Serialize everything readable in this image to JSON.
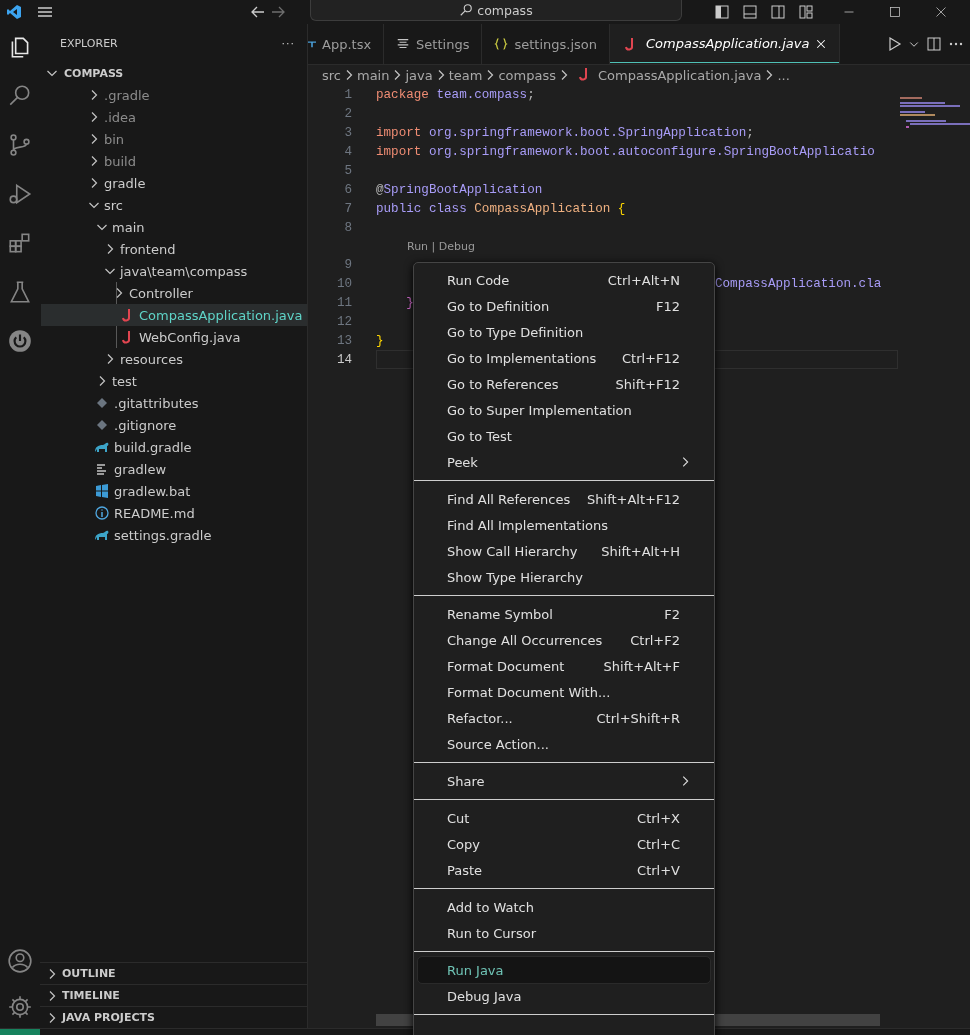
{
  "title_bar": {
    "search": "compass"
  },
  "activity_bar": {
    "top": [
      {
        "kind": "files",
        "selected": true
      },
      {
        "kind": "search",
        "selected": false
      },
      {
        "kind": "branch",
        "selected": false
      },
      {
        "kind": "debug",
        "selected": false
      },
      {
        "kind": "blocks",
        "selected": false
      },
      {
        "kind": "flask",
        "selected": false
      },
      {
        "kind": "power",
        "selected": false
      }
    ],
    "bottom": [
      {
        "kind": "account"
      },
      {
        "kind": "gear"
      }
    ]
  },
  "sidebar": {
    "title": "EXPLORER",
    "more": "···",
    "root": {
      "name": "COMPASS",
      "expanded": true
    },
    "tree": [
      {
        "name": ".gradle",
        "kind": "folder",
        "expanded": false,
        "ignored": true,
        "selected": false
      },
      {
        "name": ".idea",
        "kind": "folder",
        "expanded": false,
        "ignored": true,
        "selected": false
      },
      {
        "name": "bin",
        "kind": "folder",
        "expanded": false,
        "ignored": true,
        "selected": false
      },
      {
        "name": "build",
        "kind": "folder",
        "expanded": false,
        "ignored": true,
        "selected": false
      },
      {
        "name": "gradle",
        "kind": "folder",
        "expanded": false,
        "ignored": false,
        "selected": false
      },
      {
        "name": "src",
        "kind": "folder",
        "expanded": true,
        "ignored": false,
        "selected": false,
        "children": [
          {
            "name": "main",
            "kind": "folder",
            "expanded": true,
            "ignored": false,
            "selected": false,
            "children": [
              {
                "name": "frontend",
                "kind": "folder",
                "expanded": false,
                "ignored": false,
                "selected": false
              },
              {
                "name": "java\\team\\compass",
                "kind": "folder",
                "expanded": true,
                "ignored": false,
                "selected": false,
                "children": [
                  {
                    "name": "Controller",
                    "kind": "folder",
                    "expanded": false,
                    "ignored": false,
                    "selected": false
                  },
                  {
                    "name": "CompassApplication.java",
                    "kind": "java",
                    "ignored": false,
                    "selected": true
                  },
                  {
                    "name": "WebConfig.java",
                    "kind": "java",
                    "ignored": false,
                    "selected": false
                  }
                ]
              },
              {
                "name": "resources",
                "kind": "folder",
                "expanded": false,
                "ignored": false,
                "selected": false
              }
            ]
          },
          {
            "name": "test",
            "kind": "folder",
            "expanded": false,
            "ignored": false,
            "selected": false
          }
        ]
      },
      {
        "name": ".gitattributes",
        "kind": "git",
        "ignored": false,
        "selected": false
      },
      {
        "name": ".gitignore",
        "kind": "git",
        "ignored": false,
        "selected": false
      },
      {
        "name": "build.gradle",
        "kind": "gradle",
        "ignored": false,
        "selected": false
      },
      {
        "name": "gradlew",
        "kind": "text",
        "ignored": false,
        "selected": false
      },
      {
        "name": "gradlew.bat",
        "kind": "windows",
        "ignored": false,
        "selected": false
      },
      {
        "name": "README.md",
        "kind": "info",
        "ignored": false,
        "selected": false
      },
      {
        "name": "settings.gradle",
        "kind": "gradle",
        "ignored": false,
        "selected": false
      }
    ],
    "sections": [
      {
        "label": "OUTLINE",
        "expanded": false
      },
      {
        "label": "TIMELINE",
        "expanded": false
      },
      {
        "label": "JAVA PROJECTS",
        "expanded": false
      }
    ]
  },
  "tabs": [
    {
      "label": "App.tsx",
      "kind": "ts",
      "selected": false,
      "preview": false
    },
    {
      "label": "Settings",
      "kind": "settings",
      "selected": false,
      "preview": false
    },
    {
      "label": "settings.json",
      "kind": "json",
      "selected": false,
      "preview": false
    },
    {
      "label": "CompassApplication.java",
      "kind": "java",
      "selected": true,
      "preview": true
    }
  ],
  "breadcrumb": [
    {
      "text": "src",
      "kind": "folder"
    },
    {
      "text": "main",
      "kind": "folder"
    },
    {
      "text": "java",
      "kind": "folder"
    },
    {
      "text": "team",
      "kind": "folder"
    },
    {
      "text": "compass",
      "kind": "folder"
    },
    {
      "text": "CompassApplication.java",
      "kind": "java"
    },
    {
      "text": "...",
      "kind": "more"
    }
  ],
  "code": [
    {
      "number": "1",
      "kind": "code",
      "current": false,
      "tokens": [
        {
          "text": "package",
          "kind": "keyword"
        },
        {
          "text": " team.compass",
          "kind": "name"
        },
        {
          "text": ";",
          "kind": "plain"
        }
      ]
    },
    {
      "number": "2",
      "kind": "code",
      "current": false
    },
    {
      "number": "3",
      "kind": "code",
      "current": false,
      "tokens": [
        {
          "text": "import",
          "kind": "keyword"
        },
        {
          "text": " org.springframework.boot.SpringApplication",
          "kind": "name"
        },
        {
          "text": ";",
          "kind": "plain"
        }
      ]
    },
    {
      "number": "4",
      "kind": "code",
      "current": false,
      "tokens": [
        {
          "text": "import",
          "kind": "keyword"
        },
        {
          "text": " org.springframework.boot.autoconfigure.SpringBootApplicatio",
          "kind": "name"
        }
      ]
    },
    {
      "number": "5",
      "kind": "code",
      "current": false
    },
    {
      "number": "6",
      "kind": "code",
      "current": false,
      "tokens": [
        {
          "text": "@",
          "kind": "plain"
        },
        {
          "text": "SpringBootApplication",
          "kind": "name"
        }
      ]
    },
    {
      "number": "7",
      "kind": "code",
      "current": false,
      "tokens": [
        {
          "text": "public class",
          "kind": "name"
        },
        {
          "text": " CompassApplication ",
          "kind": "type"
        },
        {
          "text": "{",
          "kind": "brace"
        }
      ]
    },
    {
      "number": "8",
      "kind": "code",
      "current": false
    },
    {
      "kind": "codelens",
      "text": "Run | Debug"
    },
    {
      "number": "9",
      "kind": "code",
      "current": false
    },
    {
      "number": "10",
      "kind": "behind_menu",
      "current": false,
      "tokens": [
        {
          "text": "CompassApplication.cla",
          "kind": "name"
        }
      ]
    },
    {
      "number": "11",
      "kind": "code",
      "current": false,
      "tokens": [
        {
          "text": "    }",
          "kind": "brace2"
        }
      ]
    },
    {
      "number": "12",
      "kind": "code",
      "current": false
    },
    {
      "number": "13",
      "kind": "code",
      "current": false,
      "tokens": [
        {
          "text": "}",
          "kind": "brace"
        }
      ]
    },
    {
      "number": "14",
      "kind": "code",
      "current": true
    }
  ],
  "context_menu": {
    "groups": [
      [
        {
          "label": "Run Code",
          "shortcut": "Ctrl+Alt+N",
          "selected": false
        },
        {
          "label": "Go to Definition",
          "shortcut": "F12",
          "selected": false
        },
        {
          "label": "Go to Type Definition",
          "selected": false
        },
        {
          "label": "Go to Implementations",
          "shortcut": "Ctrl+F12",
          "selected": false
        },
        {
          "label": "Go to References",
          "shortcut": "Shift+F12",
          "selected": false
        },
        {
          "label": "Go to Super Implementation",
          "selected": false
        },
        {
          "label": "Go to Test",
          "selected": false
        },
        {
          "label": "Peek",
          "submenu": true,
          "selected": false
        }
      ],
      [
        {
          "label": "Find All References",
          "shortcut": "Shift+Alt+F12",
          "selected": false
        },
        {
          "label": "Find All Implementations",
          "selected": false
        },
        {
          "label": "Show Call Hierarchy",
          "shortcut": "Shift+Alt+H",
          "selected": false
        },
        {
          "label": "Show Type Hierarchy",
          "selected": false
        }
      ],
      [
        {
          "label": "Rename Symbol",
          "shortcut": "F2",
          "selected": false
        },
        {
          "label": "Change All Occurrences",
          "shortcut": "Ctrl+F2",
          "selected": false
        },
        {
          "label": "Format Document",
          "shortcut": "Shift+Alt+F",
          "selected": false
        },
        {
          "label": "Format Document With...",
          "selected": false
        },
        {
          "label": "Refactor...",
          "shortcut": "Ctrl+Shift+R",
          "selected": false
        },
        {
          "label": "Source Action...",
          "selected": false
        }
      ],
      [
        {
          "label": "Share",
          "submenu": true,
          "selected": false
        }
      ],
      [
        {
          "label": "Cut",
          "shortcut": "Ctrl+X",
          "selected": false
        },
        {
          "label": "Copy",
          "shortcut": "Ctrl+C",
          "selected": false
        },
        {
          "label": "Paste",
          "shortcut": "Ctrl+V",
          "selected": false
        }
      ],
      [
        {
          "label": "Add to Watch",
          "selected": false
        },
        {
          "label": "Run to Cursor",
          "selected": false
        }
      ],
      [
        {
          "label": "Run Java",
          "selected": true
        },
        {
          "label": "Debug Java",
          "selected": false
        }
      ]
    ]
  }
}
